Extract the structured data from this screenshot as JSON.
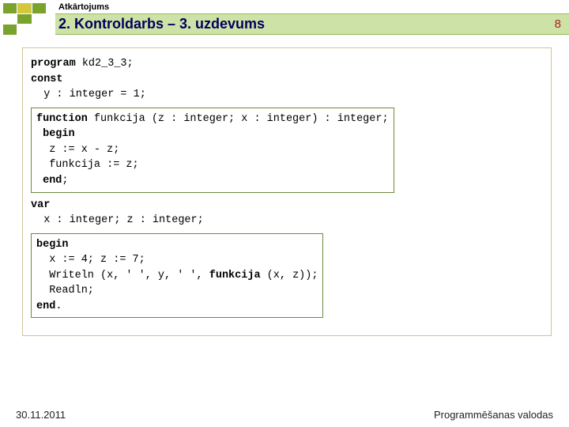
{
  "header": {
    "subtitle": "Atkārtojums",
    "title": "2. Kontroldarbs – 3. uzdevums",
    "page_number": "8"
  },
  "code": {
    "kw_program": "program",
    "prog_name": " kd2_3_3;",
    "kw_const": "const",
    "const_line": "  y : integer = 1;",
    "kw_function": "function",
    "func_sig": " funkcija (z : integer; x : integer) : integer;",
    "kw_begin1": " begin",
    "func_body1": "  z := x - z;",
    "func_body2": "  funkcija := z;",
    "kw_end1": " end",
    "semi1": ";",
    "kw_var": "var",
    "var_line": "  x : integer; z : integer;",
    "kw_begin2": "begin",
    "main1": "  x := 4; z := 7;",
    "main2a": "  Writeln (x, ' ', y, ' ', ",
    "main2b_kw": "funkcija",
    "main2c": " (x, z));",
    "main3": "  Readln;",
    "kw_end2": "end",
    "dot": "."
  },
  "footer": {
    "date": "30.11.2011",
    "course": "Programmēšanas valodas"
  }
}
